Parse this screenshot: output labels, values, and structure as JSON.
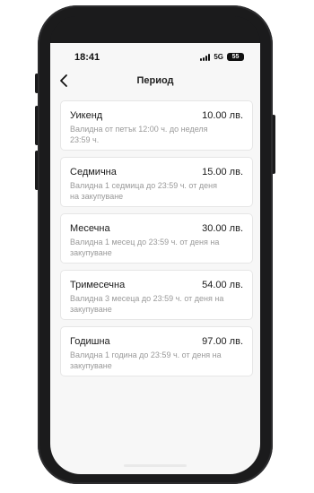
{
  "status_bar": {
    "time": "18:41",
    "network": "5G",
    "battery": "55"
  },
  "header": {
    "back_icon": "chevron-left-icon",
    "title": "Период"
  },
  "plans": [
    {
      "name": "Уикенд",
      "price": "10.00 лв.",
      "description": "Валидна от петък 12:00 ч. до неделя 23:59 ч."
    },
    {
      "name": "Седмична",
      "price": "15.00 лв.",
      "description": "Валидна 1 седмица до 23:59 ч. от деня на закупуване"
    },
    {
      "name": "Месечна",
      "price": "30.00 лв.",
      "description": "Валидна 1 месец до 23:59 ч. от деня на закупуване"
    },
    {
      "name": "Тримесечна",
      "price": "54.00 лв.",
      "description": "Валидна 3 месеца до 23:59 ч. от деня на закупуване"
    },
    {
      "name": "Годишна",
      "price": "97.00 лв.",
      "description": "Валидна 1 година до 23:59 ч. от деня на закупуване"
    }
  ],
  "colors": {
    "background": "#f7f7f7",
    "card": "#ffffff",
    "text_primary": "#1a1a1a",
    "text_secondary": "#9a9a9a",
    "phone_frame": "#1b1b1c"
  }
}
